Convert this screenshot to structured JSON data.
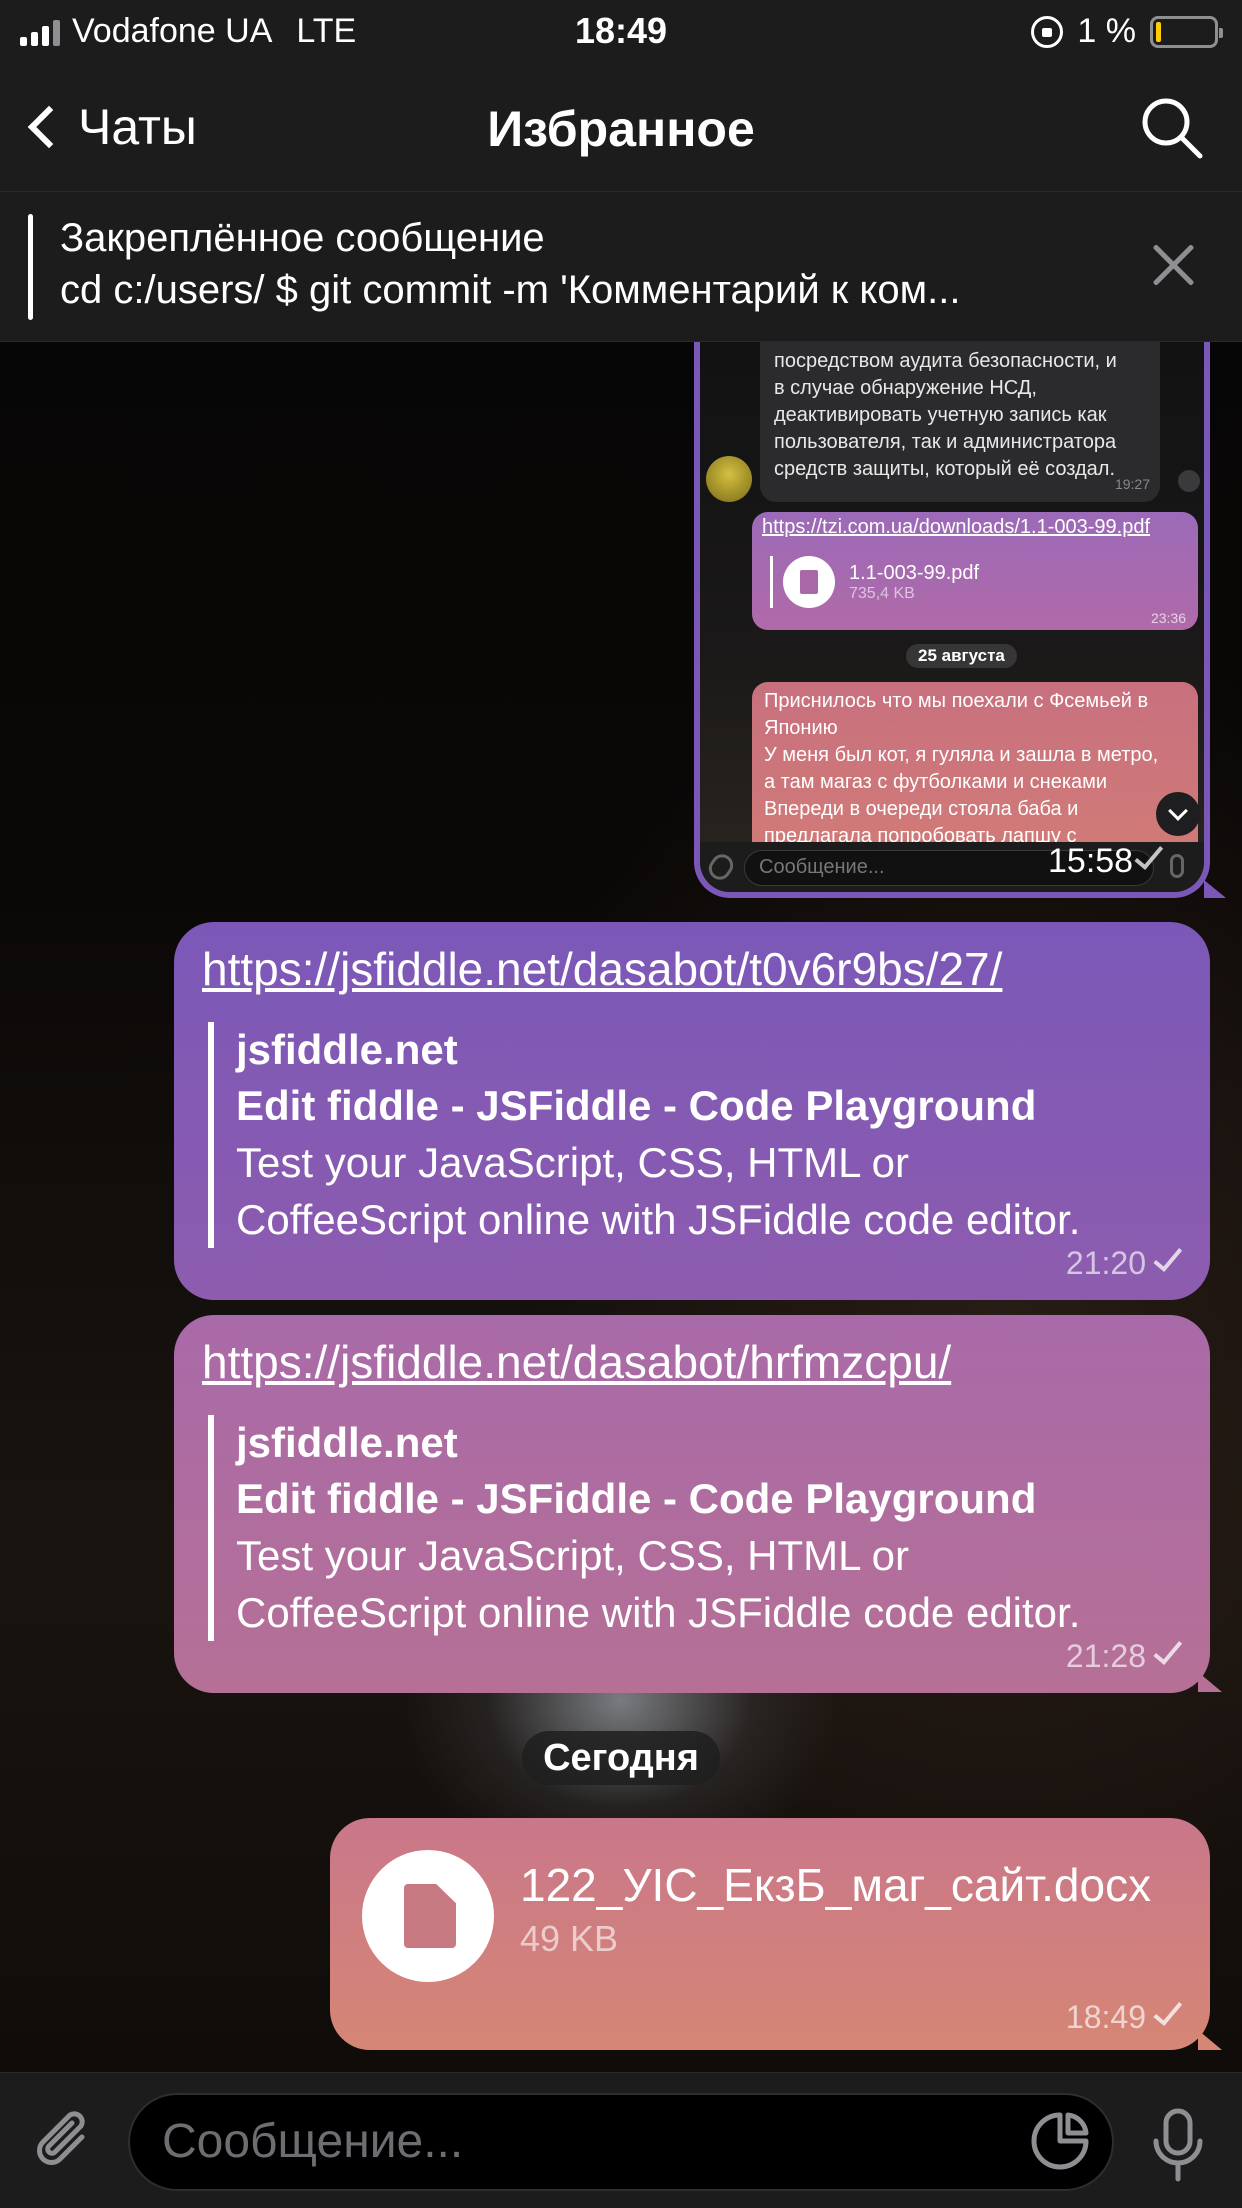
{
  "status_bar": {
    "carrier": "Vodafone UA",
    "network": "LTE",
    "time": "18:49",
    "battery": "1 %",
    "battery_level": 0.01
  },
  "nav": {
    "back_label": "Чаты",
    "title": "Избранное",
    "search_icon": "search-icon"
  },
  "pinned": {
    "title": "Закреплённое сообщение",
    "text": "cd c:/users/ $ git commit -m 'Комментарий к ком..."
  },
  "screenshot_message": {
    "msg1_lines": [
      "посредством аудита безопасности, и",
      "в случае обнаружение НСД,",
      "деактивировать учетную запись как",
      "пользователя, так и администратора",
      "средств защиты, который её создал."
    ],
    "msg1_time": "19:27",
    "msg2_link": "https://tzi.com.ua/downloads/1.1-003-99.pdf",
    "msg2_file_name": "1.1-003-99.pdf",
    "msg2_file_size": "735,4 KB",
    "msg2_time": "23:36",
    "date_label": "25 августа",
    "msg3_lines": [
      "Приснилось что мы поехали с Фсемьей в",
      "Японию",
      "У меня был кот, я гуляла и зашла в метро,",
      "а там магаз с футболками и снеками",
      "Впереди в очереди стояла баба и",
      "предлагала попробовать лапшу с"
    ],
    "input_placeholder": "Сообщение...",
    "time": "15:58"
  },
  "messages": [
    {
      "url": "https://jsfiddle.net/dasabot/t0v6r9bs/27/",
      "site": "jsfiddle.net",
      "title": "Edit fiddle - JSFiddle - Code Playground",
      "desc_line1": "Test your JavaScript, CSS, HTML or",
      "desc_line2": "CoffeeScript online with JSFiddle code editor.",
      "time": "21:20"
    },
    {
      "url": "https://jsfiddle.net/dasabot/hrfmzcpu/",
      "site": "jsfiddle.net",
      "title": "Edit fiddle - JSFiddle - Code Playground",
      "desc_line1": "Test your JavaScript, CSS, HTML or",
      "desc_line2": "CoffeeScript online with JSFiddle code editor.",
      "time": "21:28"
    }
  ],
  "date_separator": "Сегодня",
  "file_message": {
    "name": "122_УІС_ЕкзБ_маг_сайт.docx",
    "size": "49 KB",
    "time": "18:49"
  },
  "input": {
    "placeholder": "Сообщение..."
  },
  "colors": {
    "bar_bg": "#1c1c1d",
    "bubble_purple": "#7b58b8",
    "bubble_mauve": "#b67096",
    "bubble_coral": "#d68674"
  }
}
